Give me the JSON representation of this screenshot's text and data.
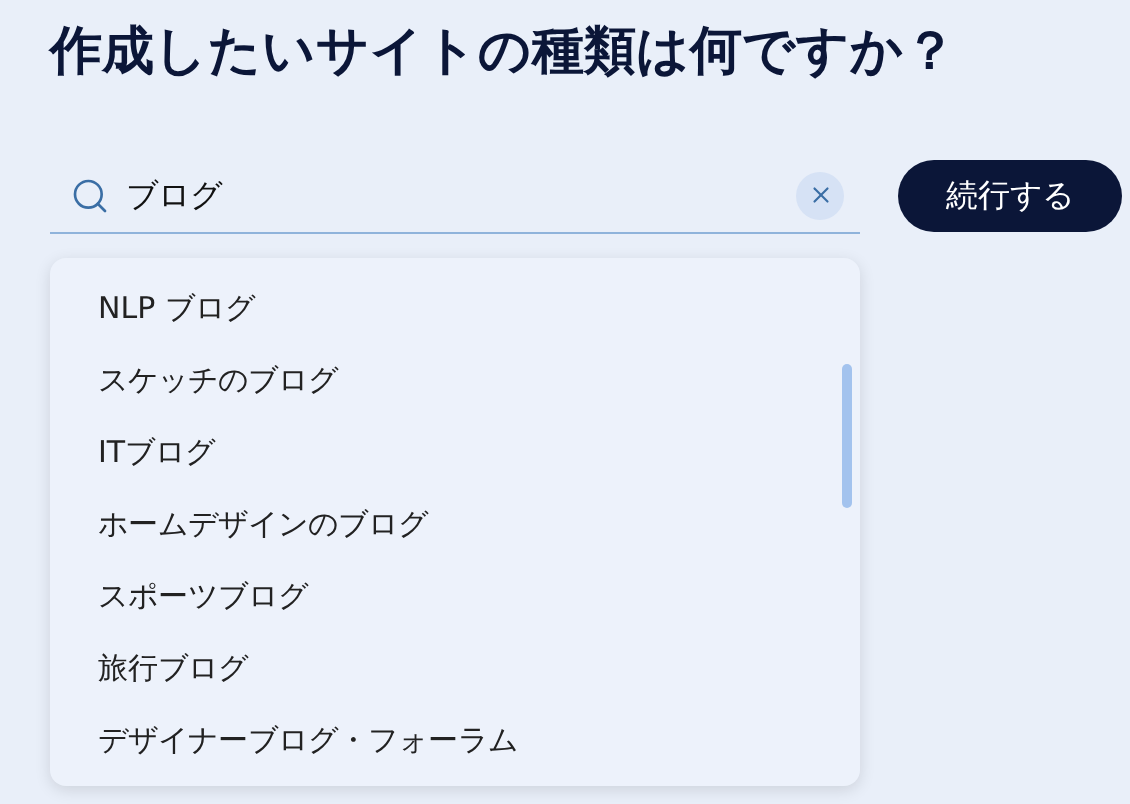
{
  "title": "作成したいサイトの種類は何ですか？",
  "search": {
    "value": "ブログ"
  },
  "continue_button": "続行する",
  "suggestions": [
    "NLP ブログ",
    "スケッチのブログ",
    "ITブログ",
    "ホームデザインのブログ",
    "スポーツブログ",
    "旅行ブログ",
    "デザイナーブログ・フォーラム"
  ]
}
